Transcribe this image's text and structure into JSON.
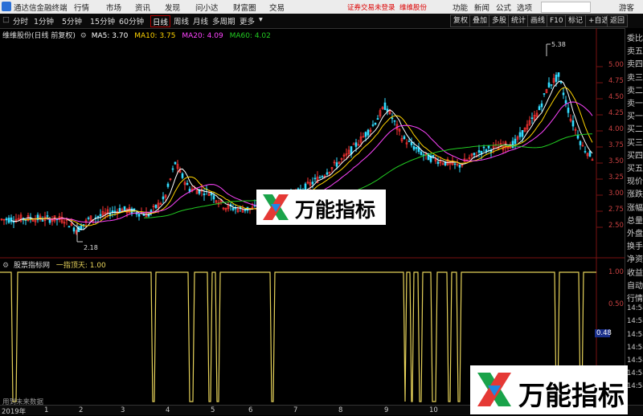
{
  "app": {
    "title": "通达信金融终端",
    "menu": [
      "行情",
      "市场",
      "资讯",
      "发现",
      "问小达",
      "财富圈",
      "交易"
    ],
    "status_notice": "证券交易未登录",
    "stock_notice": "维维股份",
    "right_menu": [
      "功能",
      "新闻",
      "公式",
      "选项",
      "游客"
    ]
  },
  "toolbar": {
    "periods": [
      "分时",
      "1分钟",
      "5分钟",
      "15分钟",
      "60分钟",
      "日线",
      "周线",
      "月线",
      "多周期",
      "更多"
    ],
    "active_period": "日线",
    "right_buttons": [
      "复权",
      "叠加",
      "多股",
      "统计",
      "画线",
      "F10",
      "标记",
      "+自选",
      "返回"
    ]
  },
  "price_chart": {
    "title": "维维股份(日线 前复权)",
    "ma_lines": [
      {
        "label": "MA5: 3.70",
        "color": "#ffffff"
      },
      {
        "label": "MA10: 3.75",
        "color": "#ffd400"
      },
      {
        "label": "MA20: 4.09",
        "color": "#ff44ff"
      },
      {
        "label": "MA60: 4.02",
        "color": "#22cc22"
      }
    ],
    "price_ticks": [
      "5.00",
      "4.75",
      "4.50",
      "4.25",
      "4.00",
      "3.75",
      "3.50",
      "3.25",
      "3.00",
      "2.75",
      "2.50"
    ],
    "high_label": "5.38",
    "low_label": "2.18"
  },
  "indicator": {
    "title": "股票指标网",
    "subtitle": "一指顶天: 1.00",
    "ticks": [
      "1.00",
      "0.50",
      "0.48"
    ]
  },
  "sidepanel": [
    "委比",
    "卖五",
    "卖四",
    "卖三",
    "卖二",
    "卖一",
    "买一",
    "买二",
    "买三",
    "买四",
    "买五",
    "现价",
    "涨跌",
    "涨幅",
    "总量",
    "外盘",
    "换手",
    "净资",
    "收益",
    "自动",
    "行情",
    "14:58",
    "14:58",
    "14:58",
    "14:58",
    "14:58",
    "14:58",
    "14:58"
  ],
  "bottom": {
    "year": "2019年",
    "months": [
      "1",
      "2",
      "3",
      "4",
      "5",
      "6",
      "7",
      "8",
      "9",
      "10",
      "11"
    ],
    "note": "用到未来数据"
  },
  "watermark": "万能指标",
  "colors": {
    "up": "#ff3333",
    "down": "#33ddff",
    "ma5": "#ffffff",
    "ma10": "#ffd400",
    "ma20": "#ff44ff",
    "ma60": "#22cc22",
    "signal": "#e6d25a"
  }
}
